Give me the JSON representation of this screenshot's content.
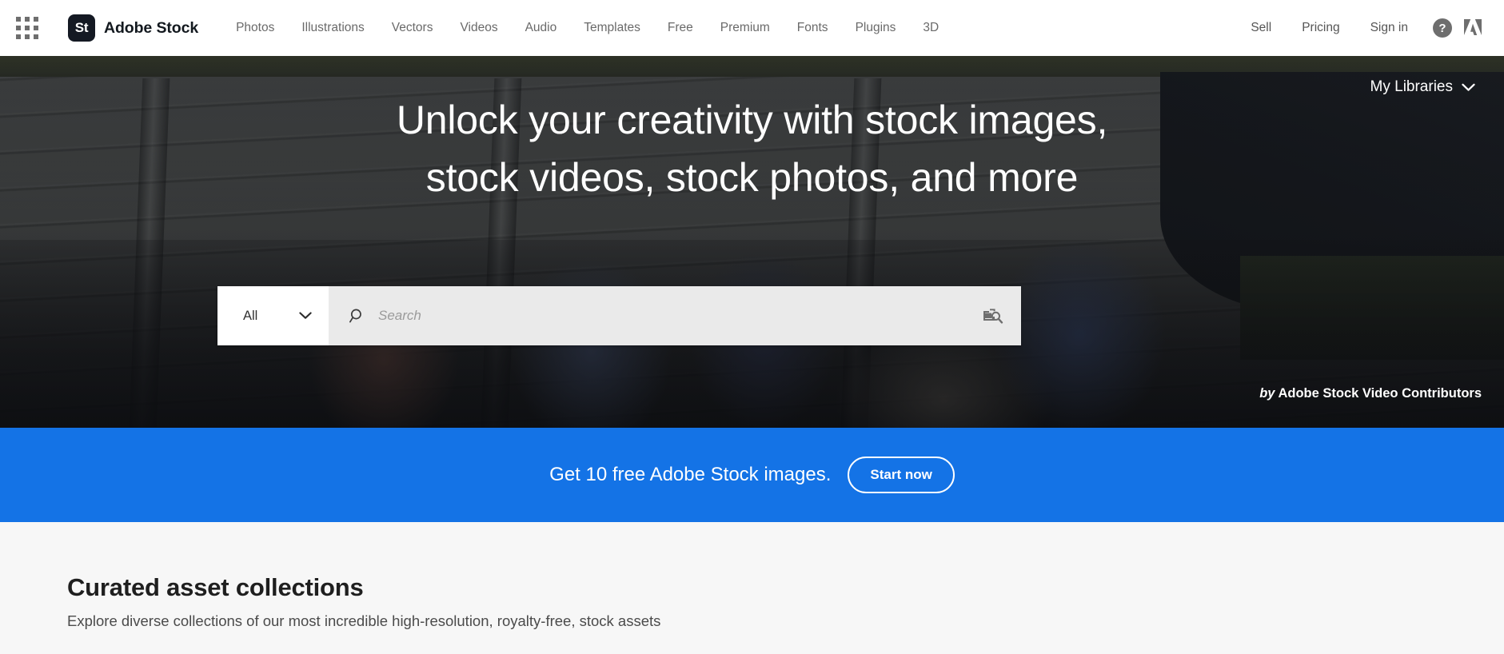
{
  "header": {
    "app_grid_icon": "app-grid-icon",
    "brand": {
      "mark": "St",
      "name": "Adobe Stock"
    },
    "nav": [
      {
        "label": "Photos"
      },
      {
        "label": "Illustrations"
      },
      {
        "label": "Vectors"
      },
      {
        "label": "Videos"
      },
      {
        "label": "Audio"
      },
      {
        "label": "Templates"
      },
      {
        "label": "Free"
      },
      {
        "label": "Premium"
      },
      {
        "label": "Fonts"
      },
      {
        "label": "Plugins"
      },
      {
        "label": "3D"
      }
    ],
    "right_nav": [
      {
        "label": "Sell"
      },
      {
        "label": "Pricing"
      },
      {
        "label": "Sign in"
      }
    ],
    "help_icon": "?",
    "help_icon_name": "help-circle-icon",
    "adobe_logo_name": "adobe-logo-icon"
  },
  "hero": {
    "my_libraries": {
      "label": "My Libraries",
      "chevron": "chevron-down-icon"
    },
    "title_line1": "Unlock your creativity with stock images,",
    "title_line2": "stock videos, stock photos, and more",
    "search": {
      "type_value": "All",
      "type_chevron": "chevron-down-icon",
      "search_icon": "magnifier-icon",
      "placeholder": "Search",
      "value": "",
      "visual_search_icon": "visual-search-icon"
    },
    "attribution_prefix": "by",
    "attribution_text": "Adobe Stock Video Contributors"
  },
  "promo": {
    "text": "Get 10 free Adobe Stock images.",
    "button_label": "Start now",
    "background_color": "#1473e6"
  },
  "collections": {
    "title": "Curated asset collections",
    "subtitle": "Explore diverse collections of our most incredible high-resolution, royalty-free, stock assets"
  }
}
